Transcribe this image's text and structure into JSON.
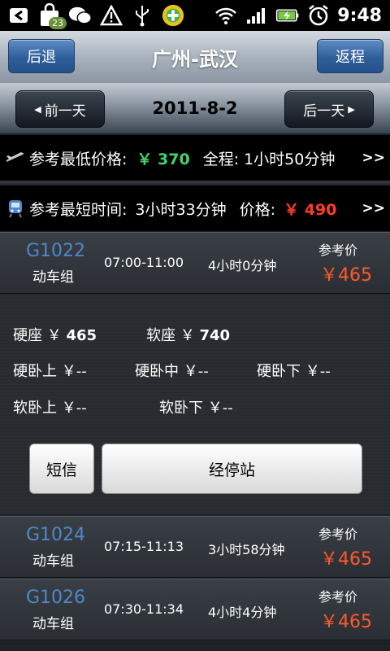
{
  "status": {
    "notification_count": "23",
    "time": "9:48"
  },
  "header": {
    "back_label": "后退",
    "title": "广州-武汉",
    "return_label": "返程"
  },
  "datebar": {
    "prev_label": "前一天",
    "date": "2011-8-2",
    "next_label": "后一天"
  },
  "summary": {
    "lowest": {
      "label": "参考最低价格:",
      "price": "￥ 370",
      "duration_label": "全程:",
      "duration": "1小时50分钟",
      "more": ">>"
    },
    "shortest": {
      "label": "参考最短时间:",
      "duration": "3小时33分钟",
      "price_label": "价格:",
      "price": "￥ 490",
      "more": ">>"
    }
  },
  "trains": [
    {
      "code": "G1022",
      "type": "动车组",
      "time": "07:00-11:00",
      "duration": "4小时0分钟",
      "ref_label": "参考价",
      "price": "￥465"
    },
    {
      "code": "G1024",
      "type": "动车组",
      "time": "07:15-11:13",
      "duration": "3小时58分钟",
      "ref_label": "参考价",
      "price": "￥465"
    },
    {
      "code": "G1026",
      "type": "动车组",
      "time": "07:30-11:34",
      "duration": "4小时4分钟",
      "ref_label": "参考价",
      "price": "￥465"
    }
  ],
  "detail": {
    "hard_seat_label": "硬座 ￥",
    "hard_seat_price": "465",
    "soft_seat_label": "软座 ￥",
    "soft_seat_price": "740",
    "hard_sleeper_upper": "硬卧上 ￥--",
    "hard_sleeper_middle": "硬卧中 ￥--",
    "hard_sleeper_lower": "硬卧下 ￥--",
    "soft_sleeper_upper": "软卧上 ￥--",
    "soft_sleeper_lower": "软卧下 ￥--",
    "sms_label": "短信",
    "stops_label": "经停站"
  },
  "colors": {
    "accent_blue": "#2f5f99",
    "train_code": "#4f88c8",
    "price_green": "#3fd26b",
    "price_red": "#ff3a2a"
  }
}
